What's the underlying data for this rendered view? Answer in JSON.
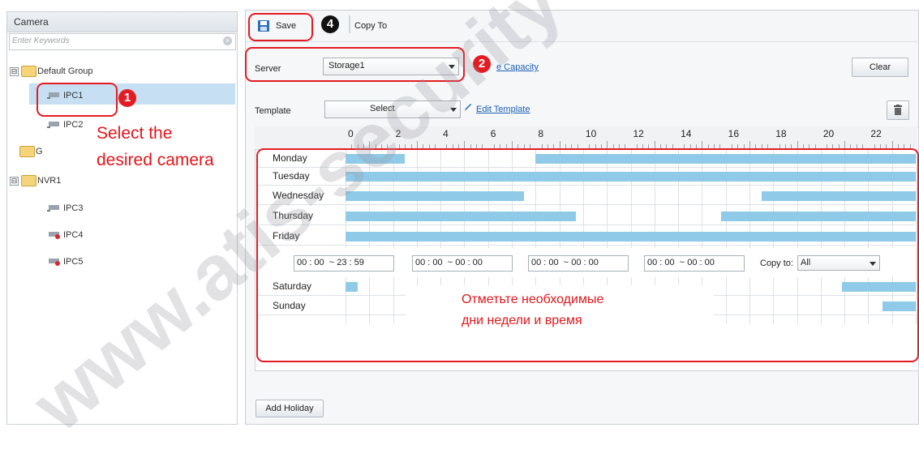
{
  "left_panel": {
    "title": "Camera",
    "search_placeholder": "Enter Keywords",
    "tree": [
      {
        "label": "Default Group",
        "type": "group",
        "expander": "⊟"
      },
      {
        "label": "IPC1",
        "type": "camera",
        "selected": true
      },
      {
        "label": "IPC2",
        "type": "camera"
      },
      {
        "label": "G",
        "type": "group"
      },
      {
        "label": "NVR1",
        "type": "group",
        "expander": "⊟"
      },
      {
        "label": "IPC3",
        "type": "camera"
      },
      {
        "label": "IPC4",
        "type": "camera-offline"
      },
      {
        "label": "IPC5",
        "type": "camera-offline"
      }
    ]
  },
  "toolbar": {
    "save_label": "Save",
    "copy_to_label": "Copy To"
  },
  "server": {
    "label": "Server",
    "value": "Storage1",
    "link": "e Capacity"
  },
  "clear_label": "Clear",
  "template": {
    "label": "Template",
    "value": "Select",
    "link": "Edit Template"
  },
  "ruler_ticks": [
    "0",
    "2",
    "4",
    "6",
    "8",
    "10",
    "12",
    "14",
    "16",
    "18",
    "20",
    "22"
  ],
  "days": [
    {
      "name": "Monday",
      "ranges": [
        [
          0,
          2.5
        ],
        [
          8,
          24
        ]
      ]
    },
    {
      "name": "Tuesday",
      "ranges": [
        [
          0,
          24
        ]
      ]
    },
    {
      "name": "Wednesday",
      "ranges": [
        [
          0,
          7.5
        ],
        [
          17.5,
          24
        ]
      ]
    },
    {
      "name": "Thursday",
      "ranges": [
        [
          0,
          9.7
        ],
        [
          15.8,
          24
        ]
      ]
    },
    {
      "name": "Friday",
      "ranges": [
        [
          0,
          24
        ]
      ]
    },
    {
      "name": "Saturday",
      "ranges": [
        [
          0,
          0.5
        ],
        [
          20.9,
          24
        ]
      ]
    },
    {
      "name": "Sunday",
      "ranges": [
        [
          22.6,
          24
        ]
      ]
    }
  ],
  "time_segments": [
    "00 : 00  ~ 23 : 59",
    "00 : 00  ~ 00 : 00",
    "00 : 00  ~ 00 : 00",
    "00 : 00  ~ 00 : 00"
  ],
  "copy_to": {
    "label": "Copy to:",
    "value": "All"
  },
  "add_holiday_label": "Add Holiday",
  "annotations": {
    "badge1": "1",
    "badge2": "2",
    "badge4": "4",
    "select_camera_line1": "Select the",
    "select_camera_line2": "desired camera",
    "note_line1": "Отметьте необходимые",
    "note_line2": "дни недели и время"
  },
  "watermark": "www.atis-security",
  "colors": {
    "bar": "#8fcbe8",
    "annotation_red": "#e31c23",
    "selection": "#c6dff3"
  }
}
